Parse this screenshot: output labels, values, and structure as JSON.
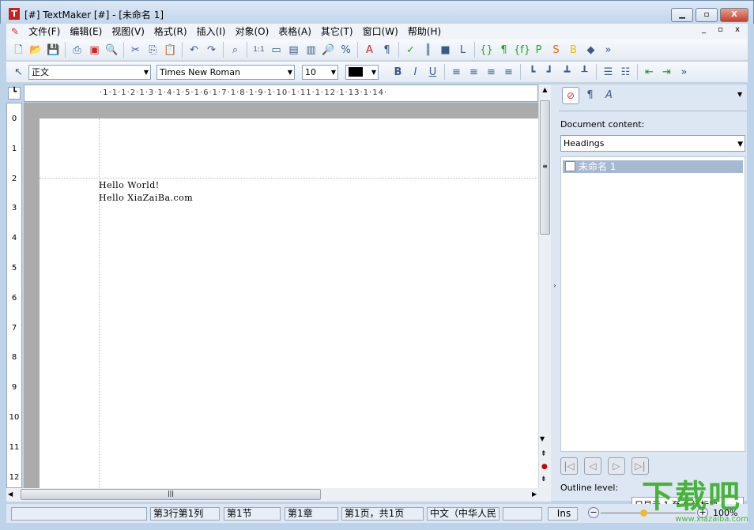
{
  "window": {
    "title": "[#] TextMaker [#] - [未命名 1]",
    "buttons": [
      "minimize",
      "maximize",
      "close"
    ]
  },
  "menu": [
    "文件(F)",
    "编辑(E)",
    "视图(V)",
    "格式(R)",
    "插入(I)",
    "对象(O)",
    "表格(A)",
    "其它(T)",
    "窗口(W)",
    "帮助(H)"
  ],
  "toolbar1": [
    "new-icon",
    "open-icon",
    "save-icon",
    "|",
    "print-icon",
    "pdf-icon",
    "print-preview-icon",
    "|",
    "cut-icon",
    "copy-icon",
    "paste-icon",
    "|",
    "undo-icon",
    "redo-icon",
    "|",
    "find-icon",
    "|",
    "zoom-100-icon",
    "page-width-icon",
    "page-icon",
    "two-pages-icon",
    "zoom-icon",
    "zoom-percent-icon",
    "|",
    "character-icon",
    "paragraph-format-icon",
    "|",
    "spellcheck-icon",
    "columns-icon",
    "shadow-icon",
    "frame-icon",
    "|",
    "fields-icon",
    "pilcrow-icon",
    "field-code-icon",
    "p-icon",
    "s-icon",
    "b-icon",
    "object-icon"
  ],
  "toolbar2": {
    "style": "正文",
    "font": "Times New Roman",
    "size": "10",
    "color": "#000000",
    "more": "»"
  },
  "ruler": {
    "marks": "·1·1·1·2·1·3·1·4·1·5·1·6·1·7·1·8·1·9·1·10·1·11·1·12·1·13·1·14·",
    "vmarks": [
      "0",
      "1",
      "2",
      "3",
      "4",
      "5",
      "6",
      "7",
      "8",
      "9",
      "10",
      "11",
      "12"
    ]
  },
  "document": {
    "lines": [
      "Hello  World!",
      "Hello  XiaZaiBa.com"
    ]
  },
  "panel": {
    "content_label": "Document content:",
    "content_select": "Headings",
    "tree_item": "未命名 1",
    "outline_label": "Outline level:",
    "outline_value": "只显示 1 至 9 级标题"
  },
  "status": {
    "cells": [
      "",
      "第3行第1列",
      "第1节",
      "第1章",
      "第1页，共1页",
      "中文（中华人民",
      ""
    ],
    "mode": "Ins",
    "zoom": "100%"
  },
  "watermark": {
    "text": "下载吧",
    "url": "www.xiazaiba.com"
  }
}
